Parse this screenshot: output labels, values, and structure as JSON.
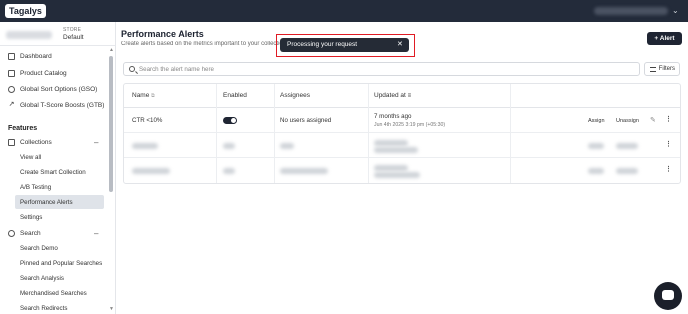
{
  "topbar": {
    "logo": "Tagalys"
  },
  "store": {
    "label": "STORE",
    "value": "Default"
  },
  "sidebar": {
    "top_items": [
      {
        "label": "Dashboard",
        "icon": "grid-icon"
      },
      {
        "label": "Product Catalog",
        "icon": "catalog-icon"
      },
      {
        "label": "Global Sort Options (GSO)",
        "icon": "sort-icon"
      },
      {
        "label": "Global T-Score Boosts (GTB)",
        "icon": "trend-icon"
      }
    ],
    "features_heading": "Features",
    "collections": {
      "label": "Collections",
      "items": [
        "View all",
        "Create Smart Collection",
        "A/B Testing",
        "Performance Alerts",
        "Settings"
      ]
    },
    "search": {
      "label": "Search",
      "items": [
        "Search Demo",
        "Pinned and Popular Searches",
        "Search Analysis",
        "Merchandised Searches",
        "Search Redirects"
      ]
    }
  },
  "main": {
    "title": "Performance Alerts",
    "subtitle": "Create alerts based on the metrics important to your collections",
    "add_button": "+ Alert",
    "search_placeholder": "Search the alert name here",
    "filters_label": "Filters",
    "columns": [
      "Name",
      "Enabled",
      "Assignees",
      "Updated at"
    ],
    "rows": [
      {
        "name": "CTR <10%",
        "enabled": true,
        "assignees": "No users assigned",
        "updated": "7 months ago",
        "updated_detail": "Jun 4th 2025 3:19 pm (+05:30)",
        "assign": "Assign",
        "unassign": "Unassign"
      }
    ]
  },
  "toast": {
    "text": "Processing your request",
    "close": "✕"
  }
}
